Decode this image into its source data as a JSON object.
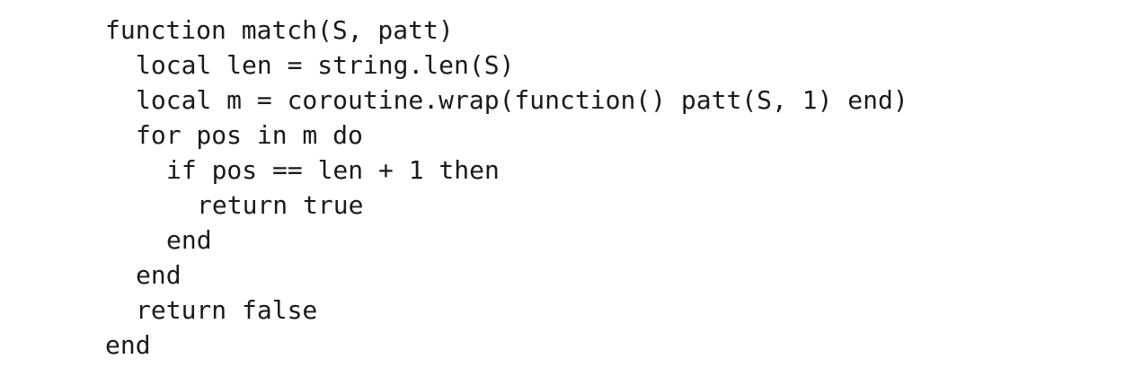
{
  "code": {
    "lines": [
      {
        "text": "function match(S, patt)"
      },
      {
        "text": "local len = string.len(S)"
      },
      {
        "text": "local m = coroutine.wrap(function() patt(S, 1) end)"
      },
      {
        "text": "for pos in m do"
      },
      {
        "text": "if pos == len + 1 then"
      },
      {
        "text": "return true"
      },
      {
        "text": "end"
      },
      {
        "text": "end"
      },
      {
        "text": "return false"
      },
      {
        "text": "end"
      }
    ]
  }
}
